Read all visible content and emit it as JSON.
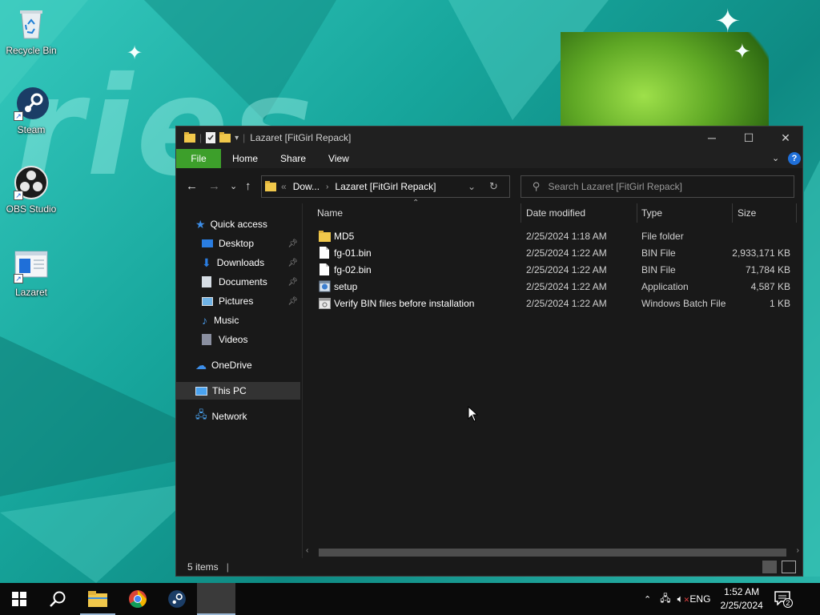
{
  "desktop": {
    "wallpaper_text": "ries",
    "icons": [
      {
        "label": "Recycle Bin",
        "icon": "recycle-bin-icon"
      },
      {
        "label": "Steam",
        "icon": "steam-icon"
      },
      {
        "label": "OBS Studio",
        "icon": "obs-icon"
      },
      {
        "label": "Lazaret",
        "icon": "document-icon"
      }
    ]
  },
  "window": {
    "title": "Lazaret [FitGirl Repack]",
    "ribbon_tabs": [
      "File",
      "Home",
      "Share",
      "View"
    ],
    "address": {
      "parent": "Dow...",
      "current": "Lazaret [FitGirl Repack]",
      "overflow": "«"
    },
    "search_placeholder": "Search Lazaret [FitGirl Repack]",
    "nav": {
      "quick_access": "Quick access",
      "items": [
        {
          "label": "Desktop",
          "pinned": true
        },
        {
          "label": "Downloads",
          "pinned": true
        },
        {
          "label": "Documents",
          "pinned": true
        },
        {
          "label": "Pictures",
          "pinned": true
        },
        {
          "label": "Music",
          "pinned": false
        },
        {
          "label": "Videos",
          "pinned": false
        }
      ],
      "onedrive": "OneDrive",
      "this_pc": "This PC",
      "network": "Network"
    },
    "columns": {
      "name": "Name",
      "date": "Date modified",
      "type": "Type",
      "size": "Size"
    },
    "files": [
      {
        "name": "MD5",
        "date": "2/25/2024 1:18 AM",
        "type": "File folder",
        "size": "",
        "icon": "folder-icon"
      },
      {
        "name": "fg-01.bin",
        "date": "2/25/2024 1:22 AM",
        "type": "BIN File",
        "size": "2,933,171 KB",
        "icon": "file-icon"
      },
      {
        "name": "fg-02.bin",
        "date": "2/25/2024 1:22 AM",
        "type": "BIN File",
        "size": "71,784 KB",
        "icon": "file-icon"
      },
      {
        "name": "setup",
        "date": "2/25/2024 1:22 AM",
        "type": "Application",
        "size": "4,587 KB",
        "icon": "setup-icon"
      },
      {
        "name": "Verify BIN files before installation",
        "date": "2/25/2024 1:22 AM",
        "type": "Windows Batch File",
        "size": "1 KB",
        "icon": "batch-file-icon"
      }
    ],
    "status": "5 items"
  },
  "taskbar": {
    "time": "1:52 AM",
    "date": "2/25/2024",
    "language": "ENG",
    "notification_count": "2"
  },
  "colors": {
    "accent_file_tab": "#3d9f2b",
    "window_bg": "#191919",
    "selected_nav": "#333333"
  }
}
